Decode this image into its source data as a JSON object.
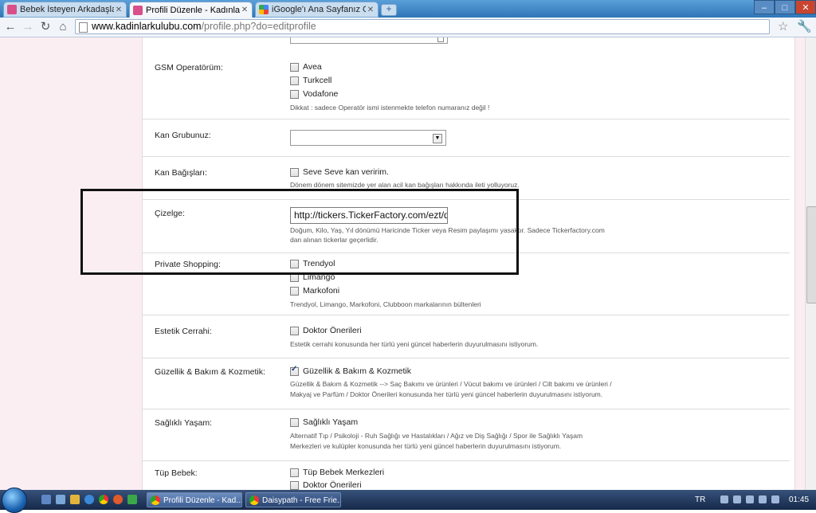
{
  "browser": {
    "tabs": [
      {
        "title": "Bebek İsteyen Arkadaşların",
        "active": false
      },
      {
        "title": "Profili Düzenle - Kadınlar K",
        "active": true
      },
      {
        "title": "iGoogle'ı Ana Sayfanız Ola",
        "active": false
      }
    ],
    "new_tab": "+",
    "window_buttons": {
      "minimize": "–",
      "maximize": "□",
      "close": "✕"
    },
    "url_host": "www.kadinlarkulubu.com",
    "url_path": "/profile.php?do=editprofile"
  },
  "form": {
    "gsm": {
      "label": "GSM Operatörüm:",
      "options": [
        "Avea",
        "Turkcell",
        "Vodafone"
      ],
      "hint": "Dikkat : sadece Operatör ismi istenmekte telefon numaranız değil !"
    },
    "blood": {
      "label": "Kan Grubunuz:",
      "value": ""
    },
    "donation": {
      "label": "Kan Bağışları:",
      "option": "Seve Seve kan veririm.",
      "hint": "Dönem dönem sitemizde yer alan acil kan bağışları hakkında ileti yolluyoruz."
    },
    "chart": {
      "label": "Çizelge:",
      "value": "http://tickers.TickerFactory.com/ezt/d/",
      "hint1": "Doğum, Kilo, Yaş, Yıl dönümü Haricinde Ticker veya Resim paylaşımı yasaktır. Sadece Tickerfactory.com",
      "hint2": "dan alınan tickerlar geçerlidir."
    },
    "shopping": {
      "label": "Private Shopping:",
      "options": [
        "Trendyol",
        "Limango",
        "Markofoni"
      ],
      "hint": "Trendyol, Limango, Markofoni, Clubboon markalarının bültenleri"
    },
    "aesthetic": {
      "label": "Estetik Cerrahi:",
      "option": "Doktor Önerileri",
      "hint": "Estetik cerrahi konusunda her türlü yeni güncel haberlerin duyurulmasını istiyorum."
    },
    "beauty": {
      "label": "Güzellik & Bakım & Kozmetik:",
      "option": "Güzellik & Bakım & Kozmetik",
      "checked": true,
      "hint1": "Güzellik & Bakım & Kozmetik --> Saç Bakımı ve ürünleri / Vücut bakımı ve ürünleri / Cilt bakımı ve ürünleri /",
      "hint2": "Makyaj ve Parfüm / Doktor Önerileri konusunda her türlü yeni güncel haberlerin duyurulmasını istiyorum."
    },
    "health": {
      "label": "Sağlıklı Yaşam:",
      "option": "Sağlıklı Yaşam",
      "hint1": "Alternatif Tıp / Psikoloji - Ruh Sağlığı ve Hastalıkları / Ağız ve Diş Sağlığı / Spor ile Sağlıklı Yaşam",
      "hint2": "Merkezleri ve kulüpler konusunda her türlü yeni güncel haberlerin duyurulmasını istiyorum."
    },
    "ivf": {
      "label": "Tüp Bebek:",
      "options": [
        "Tüp Bebek Merkezleri",
        "Doktor Önerileri"
      ]
    }
  },
  "taskbar": {
    "tasks": [
      "Profili Düzenle - Kad...",
      "Daisypath - Free Frie..."
    ],
    "lang": "TR",
    "clock": "01:45"
  }
}
